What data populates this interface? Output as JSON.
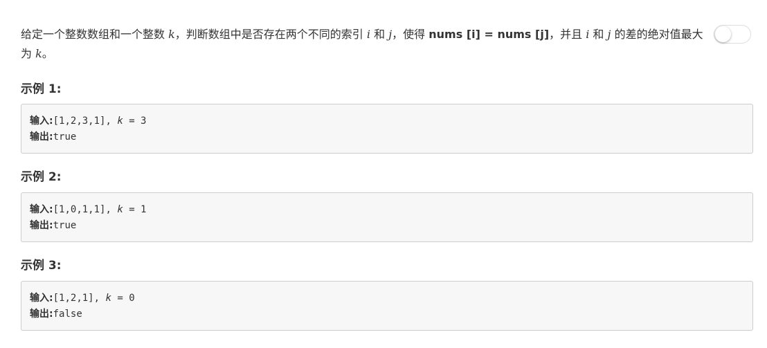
{
  "problem": {
    "segments": [
      "给定一个整数数组和一个整数 ",
      "k",
      "，判断数组中是否存在两个不同的索引 ",
      "i",
      " 和 ",
      "j",
      "，使得 ",
      "nums [i] = nums [j]",
      "，并且 ",
      "i",
      " 和 ",
      "j",
      " 的差的绝对值最大为 ",
      "k",
      "。"
    ]
  },
  "toggle": {
    "state": "off"
  },
  "examples": [
    {
      "title": "示例 1:",
      "input_label": "输入:",
      "input_prefix": "[1,2,3,1], ",
      "k_var": "k",
      "input_suffix": " = 3",
      "output_label": "输出:",
      "output_value": "true"
    },
    {
      "title": "示例 2:",
      "input_label": "输入:",
      "input_prefix": "[1,0,1,1], ",
      "k_var": "k",
      "input_suffix": " = 1",
      "output_label": "输出:",
      "output_value": "true"
    },
    {
      "title": "示例 3:",
      "input_label": "输入:",
      "input_prefix": "[1,2,1], ",
      "k_var": "k",
      "input_suffix": " = 0",
      "output_label": "输出:",
      "output_value": "false"
    }
  ]
}
